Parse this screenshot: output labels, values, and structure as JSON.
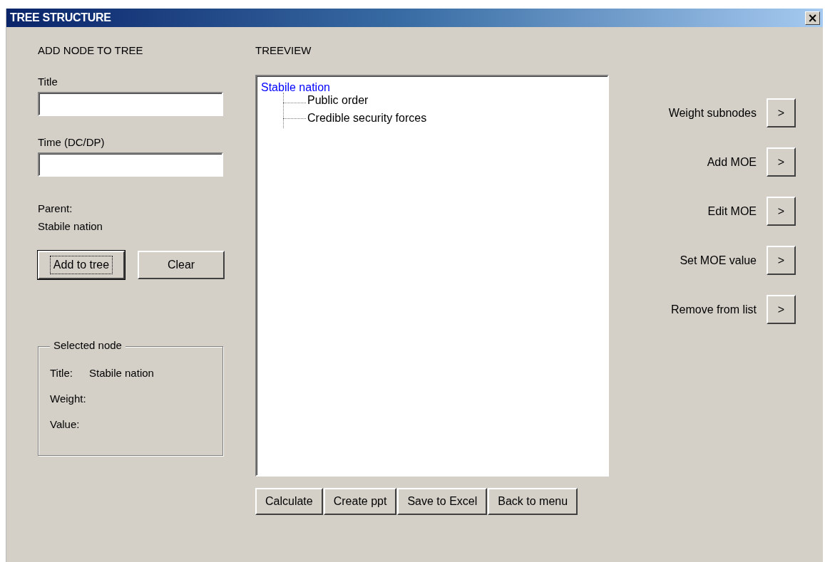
{
  "window": {
    "title": "TREE STRUCTURE",
    "close": "×"
  },
  "add_node": {
    "heading": "ADD NODE TO TREE",
    "fields": [
      {
        "label": "Title"
      },
      {
        "label": "Time (DC/DP)"
      }
    ],
    "parent_label": "Parent:",
    "parent_value": "Stabile nation",
    "buttons": [
      {
        "label": "Add to tree",
        "focused": true
      },
      {
        "label": "Clear",
        "focused": false
      }
    ],
    "selected_node": {
      "caption": "Selected node",
      "rows": [
        {
          "label": "Title:",
          "value": "Stabile nation"
        },
        {
          "label": "Weight:"
        },
        {
          "label": "Value:"
        }
      ]
    }
  },
  "treeview": {
    "heading": "TREEVIEW",
    "nodes": [
      {
        "label": "Stabile nation",
        "selected": true,
        "children": [
          {
            "label": "Public order",
            "selected": false
          },
          {
            "label": "Credible security forces",
            "selected": false
          }
        ]
      }
    ],
    "buttons": [
      "Calculate",
      "Create ppt",
      "Save to Excel",
      "Back to menu"
    ]
  },
  "actions": [
    {
      "label": "Weight subnodes",
      "button": ">"
    },
    {
      "label": "Add MOE",
      "button": ">"
    },
    {
      "label": "Edit MOE",
      "button": ">"
    },
    {
      "label": "Set MOE value",
      "button": ">"
    },
    {
      "label": "Remove from list",
      "button": ">"
    }
  ]
}
